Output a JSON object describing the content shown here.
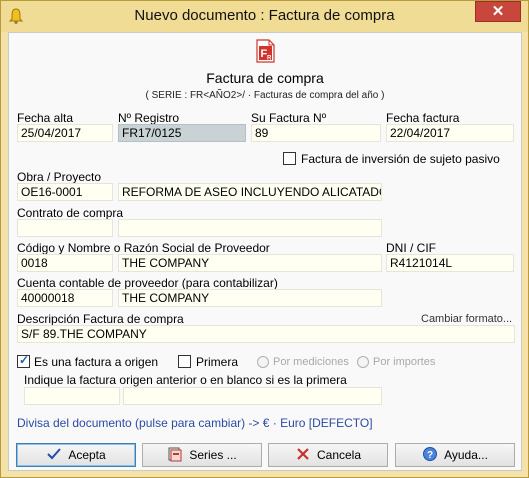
{
  "window": {
    "title": "Nuevo documento : Factura de compra",
    "close_glyph": "✕"
  },
  "header": {
    "icon": "invoice-fr-icon",
    "icon_text": "F",
    "icon_sub": "R",
    "title": "Factura de compra",
    "subtitle": "( SERIE : FR<AÑO2>/ · Facturas de compra del año )"
  },
  "fields": {
    "fecha_alta": {
      "label": "Fecha alta",
      "value": "25/04/2017"
    },
    "num_registro": {
      "label": "Nº Registro",
      "value": "FR17/0125"
    },
    "su_factura": {
      "label": "Su Factura Nº",
      "value": "89"
    },
    "fecha_factura": {
      "label": "Fecha factura",
      "value": "22/04/2017"
    },
    "inversion_label": "Factura de inversión de sujeto pasivo",
    "obra": {
      "label": "Obra / Proyecto",
      "code": "OE16-0001",
      "name": "REFORMA DE ASEO INCLUYENDO ALICATADO"
    },
    "contrato": {
      "label": "Contrato de compra",
      "code": "",
      "name": ""
    },
    "proveedor": {
      "label": "Código y Nombre o Razón Social de Proveedor",
      "code": "0018",
      "name": "THE COMPANY"
    },
    "dni": {
      "label": "DNI / CIF",
      "value": "R4121014L"
    },
    "cuenta": {
      "label": "Cuenta contable de proveedor (para contabilizar)",
      "code": "40000018",
      "name": "THE COMPANY"
    },
    "descripcion": {
      "label": "Descripción Factura de compra",
      "value": "S/F 89.THE COMPANY",
      "change_link": "Cambiar formato..."
    }
  },
  "origen": {
    "es_origen_label": "Es una factura a origen",
    "es_origen_checked": true,
    "primera_label": "Primera",
    "primera_checked": false,
    "por_mediciones": "Por mediciones",
    "por_importes": "Por importes",
    "hint": "Indique la factura origen anterior o en blanco si es la primera",
    "code": "",
    "name": ""
  },
  "divisa": "Divisa del documento (pulse para cambiar) -> € · Euro [DEFECTO]",
  "buttons": {
    "acepta": "Acepta",
    "series": "Series ...",
    "cancela": "Cancela",
    "ayuda": "Ayuda..."
  },
  "colors": {
    "frame": "#f4e2a8",
    "field_bg": "#fffff2",
    "field_gray": "#c9d3d6",
    "link_blue": "#2b4aa6",
    "icon_red": "#d0342c"
  }
}
